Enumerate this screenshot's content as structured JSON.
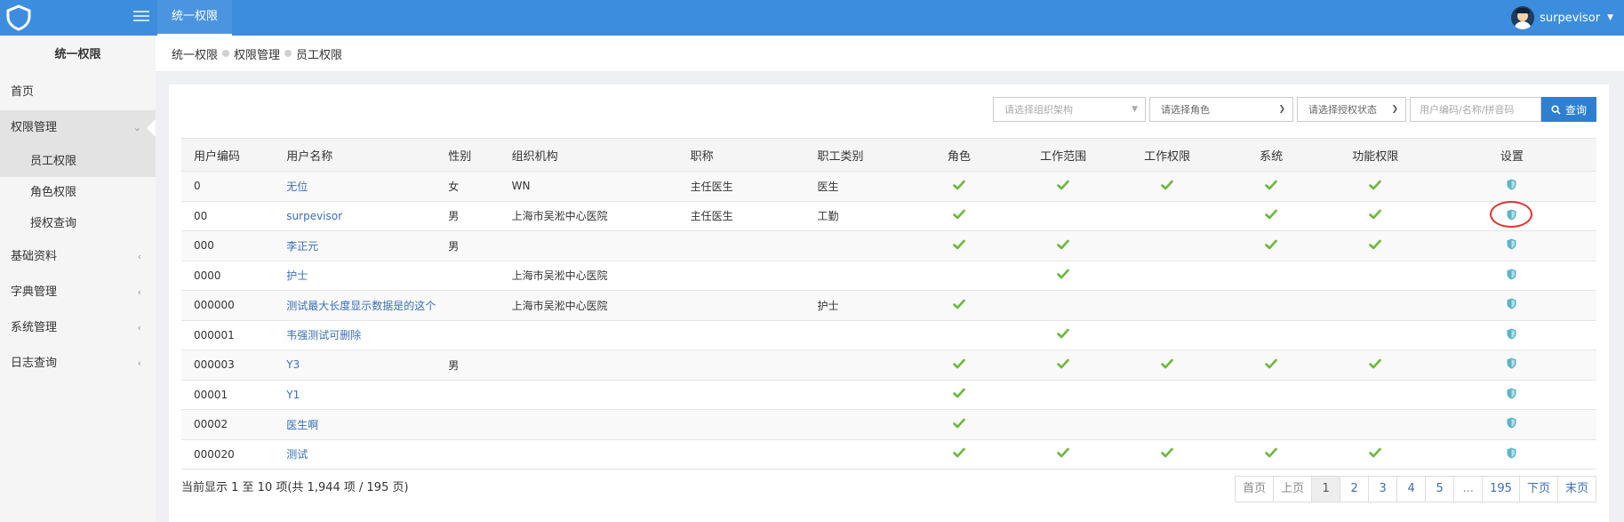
{
  "app": {
    "top_tab": "统一权限",
    "user": "surpevisor"
  },
  "sidebar": {
    "title": "统一权限",
    "items": [
      {
        "label": "首页"
      },
      {
        "label": "权限管理",
        "open": true,
        "children": [
          "员工权限",
          "角色权限",
          "授权查询"
        ]
      },
      {
        "label": "基础资料"
      },
      {
        "label": "字典管理"
      },
      {
        "label": "系统管理"
      },
      {
        "label": "日志查询"
      }
    ]
  },
  "breadcrumb": [
    "统一权限",
    "权限管理",
    "员工权限"
  ],
  "filters": {
    "org_placeholder": "请选择组织架构",
    "role_placeholder": "请选择角色",
    "auth_placeholder": "请选择授权状态",
    "search_placeholder": "用户编码/名称/拼音码",
    "query_label": "查询"
  },
  "table": {
    "columns": [
      "用户编码",
      "用户名称",
      "性别",
      "组织机构",
      "职称",
      "职工类别",
      "角色",
      "工作范围",
      "工作权限",
      "系统",
      "功能权限",
      "设置"
    ],
    "rows": [
      {
        "code": "0",
        "name": "无位",
        "gender": "女",
        "org": "WN",
        "title": "主任医生",
        "category": "医生",
        "role": true,
        "scope": true,
        "work": true,
        "system": true,
        "func": true
      },
      {
        "code": "00",
        "name": "surpevisor",
        "gender": "男",
        "org": "上海市吴淞中心医院",
        "title": "主任医生",
        "category": "工勤",
        "role": true,
        "scope": false,
        "work": false,
        "system": true,
        "func": true
      },
      {
        "code": "000",
        "name": "李正元",
        "gender": "男",
        "org": "",
        "title": "",
        "category": "",
        "role": true,
        "scope": true,
        "work": false,
        "system": true,
        "func": true
      },
      {
        "code": "0000",
        "name": "护士",
        "gender": "",
        "org": "上海市吴淞中心医院",
        "title": "",
        "category": "",
        "role": false,
        "scope": true,
        "work": false,
        "system": false,
        "func": false
      },
      {
        "code": "000000",
        "name": "测试最大长度显示数据是的这个",
        "gender": "",
        "org": "上海市吴淞中心医院",
        "title": "",
        "category": "护士",
        "role": true,
        "scope": false,
        "work": false,
        "system": false,
        "func": false
      },
      {
        "code": "000001",
        "name": "韦强测试可删除",
        "gender": "",
        "org": "",
        "title": "",
        "category": "",
        "role": false,
        "scope": true,
        "work": false,
        "system": false,
        "func": false
      },
      {
        "code": "000003",
        "name": "Y3",
        "gender": "男",
        "org": "",
        "title": "",
        "category": "",
        "role": true,
        "scope": true,
        "work": true,
        "system": true,
        "func": true
      },
      {
        "code": "00001",
        "name": "Y1",
        "gender": "",
        "org": "",
        "title": "",
        "category": "",
        "role": true,
        "scope": false,
        "work": false,
        "system": false,
        "func": false
      },
      {
        "code": "00002",
        "name": "医生啊",
        "gender": "",
        "org": "",
        "title": "",
        "category": "",
        "role": true,
        "scope": false,
        "work": false,
        "system": false,
        "func": false
      },
      {
        "code": "000020",
        "name": "测试",
        "gender": "",
        "org": "",
        "title": "",
        "category": "",
        "role": true,
        "scope": true,
        "work": true,
        "system": true,
        "func": true
      }
    ]
  },
  "summary": "当前显示 1 至 10 项(共 1,944 项 / 195 页)",
  "pagination": {
    "first": "首页",
    "prev": "上页",
    "pages": [
      "1",
      "2",
      "3",
      "4",
      "5"
    ],
    "active": "1",
    "ellipsis": "...",
    "last_page": "195",
    "next": "下页",
    "last": "末页"
  },
  "colors": {
    "topbar": "#3c8dde",
    "check": "#6ab83c",
    "shield": "#5bb5c9",
    "link": "#3a6fb6",
    "highlight_circle": "#e2332f"
  },
  "icons": {
    "check": "check-icon",
    "shield": "shield-icon",
    "search": "search-icon"
  }
}
